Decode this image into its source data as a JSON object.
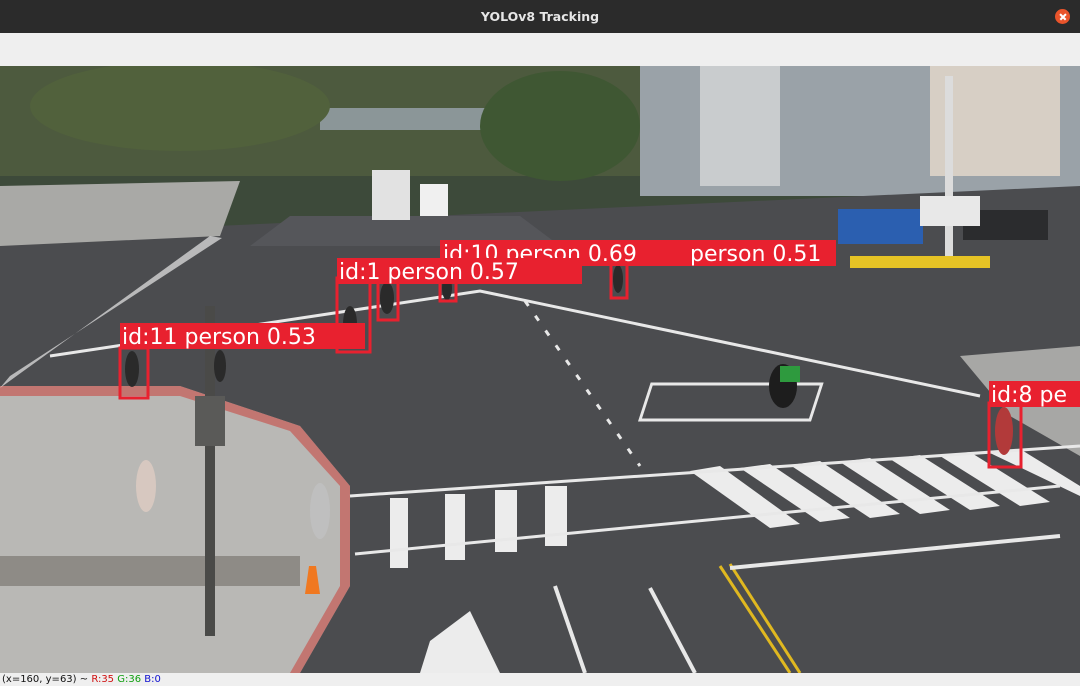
{
  "window": {
    "title": "YOLOv8 Tracking"
  },
  "detections": [
    {
      "label": "id:10 person 0.69"
    },
    {
      "label": "person 0.51"
    },
    {
      "label": "id:1 person 0.57"
    },
    {
      "label": "id:11 person 0.53"
    },
    {
      "label": "id:8 pe"
    }
  ],
  "status": {
    "coords": "(x=160, y=63) ~",
    "r": "R:35",
    "g": "G:36",
    "b": "B:0"
  },
  "colors": {
    "box": "#e8212f",
    "titlebar": "#2b2b2b",
    "close": "#e9542b"
  }
}
